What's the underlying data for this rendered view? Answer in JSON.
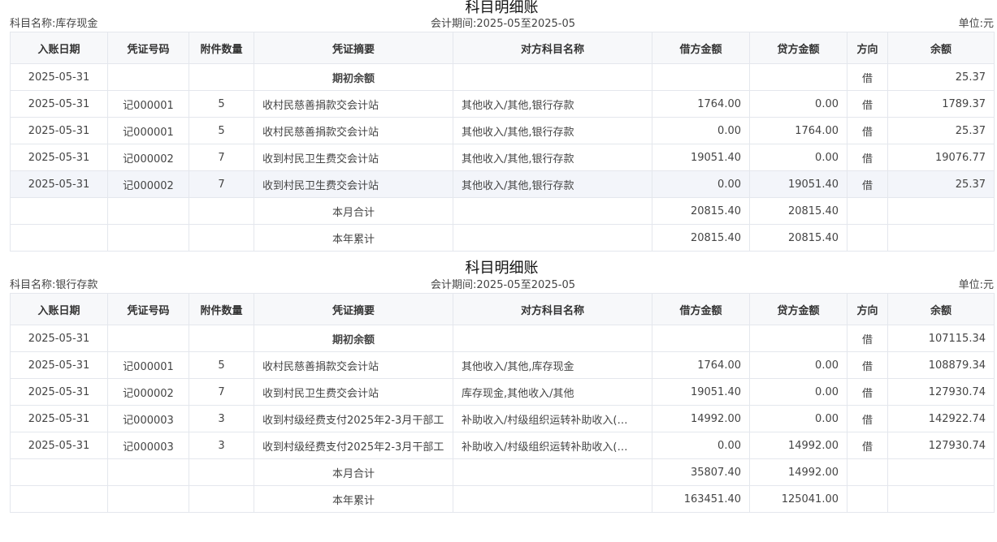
{
  "columns": [
    "入账日期",
    "凭证号码",
    "附件数量",
    "凭证摘要",
    "对方科目名称",
    "借方金额",
    "贷方金额",
    "方向",
    "余额"
  ],
  "ledgers": [
    {
      "title": "科目明细账",
      "subject": "科目名称:库存现金",
      "period": "会计期间:2025-05至2025-05",
      "unit": "单位:元",
      "rows": [
        {
          "date": "2025-05-31",
          "voucher": "",
          "attach": "",
          "summary": "期初余额",
          "counter": "",
          "debit": "",
          "credit": "",
          "dir": "借",
          "balance": "25.37"
        },
        {
          "date": "2025-05-31",
          "voucher": "记000001",
          "attach": "5",
          "summary": "收村民慈善捐款交会计站",
          "counter": "其他收入/其他,银行存款",
          "debit": "1764.00",
          "credit": "0.00",
          "dir": "借",
          "balance": "1789.37"
        },
        {
          "date": "2025-05-31",
          "voucher": "记000001",
          "attach": "5",
          "summary": "收村民慈善捐款交会计站",
          "counter": "其他收入/其他,银行存款",
          "debit": "0.00",
          "credit": "1764.00",
          "dir": "借",
          "balance": "25.37"
        },
        {
          "date": "2025-05-31",
          "voucher": "记000002",
          "attach": "7",
          "summary": "收到村民卫生费交会计站",
          "counter": "其他收入/其他,银行存款",
          "debit": "19051.40",
          "credit": "0.00",
          "dir": "借",
          "balance": "19076.77"
        },
        {
          "date": "2025-05-31",
          "voucher": "记000002",
          "attach": "7",
          "summary": "收到村民卫生费交会计站",
          "counter": "其他收入/其他,银行存款",
          "debit": "0.00",
          "credit": "19051.40",
          "dir": "借",
          "balance": "25.37"
        },
        {
          "date": "",
          "voucher": "",
          "attach": "",
          "summary": "本月合计",
          "counter": "",
          "debit": "20815.40",
          "credit": "20815.40",
          "dir": "",
          "balance": ""
        },
        {
          "date": "",
          "voucher": "",
          "attach": "",
          "summary": "本年累计",
          "counter": "",
          "debit": "20815.40",
          "credit": "20815.40",
          "dir": "",
          "balance": ""
        }
      ]
    },
    {
      "title": "科目明细账",
      "subject": "科目名称:银行存款",
      "period": "会计期间:2025-05至2025-05",
      "unit": "单位:元",
      "rows": [
        {
          "date": "2025-05-31",
          "voucher": "",
          "attach": "",
          "summary": "期初余额",
          "counter": "",
          "debit": "",
          "credit": "",
          "dir": "借",
          "balance": "107115.34"
        },
        {
          "date": "2025-05-31",
          "voucher": "记000001",
          "attach": "5",
          "summary": "收村民慈善捐款交会计站",
          "counter": "其他收入/其他,库存现金",
          "debit": "1764.00",
          "credit": "0.00",
          "dir": "借",
          "balance": "108879.34"
        },
        {
          "date": "2025-05-31",
          "voucher": "记000002",
          "attach": "7",
          "summary": "收到村民卫生费交会计站",
          "counter": "库存现金,其他收入/其他",
          "debit": "19051.40",
          "credit": "0.00",
          "dir": "借",
          "balance": "127930.74"
        },
        {
          "date": "2025-05-31",
          "voucher": "记000003",
          "attach": "3",
          "summary": "收到村级经费支付2025年2-3月干部工",
          "counter": "补助收入/村级组织运转补助收入(…",
          "debit": "14992.00",
          "credit": "0.00",
          "dir": "借",
          "balance": "142922.74"
        },
        {
          "date": "2025-05-31",
          "voucher": "记000003",
          "attach": "3",
          "summary": "收到村级经费支付2025年2-3月干部工",
          "counter": "补助收入/村级组织运转补助收入(…",
          "debit": "0.00",
          "credit": "14992.00",
          "dir": "借",
          "balance": "127930.74"
        },
        {
          "date": "",
          "voucher": "",
          "attach": "",
          "summary": "本月合计",
          "counter": "",
          "debit": "35807.40",
          "credit": "14992.00",
          "dir": "",
          "balance": ""
        },
        {
          "date": "",
          "voucher": "",
          "attach": "",
          "summary": "本年累计",
          "counter": "",
          "debit": "163451.40",
          "credit": "125041.00",
          "dir": "",
          "balance": ""
        }
      ]
    }
  ]
}
